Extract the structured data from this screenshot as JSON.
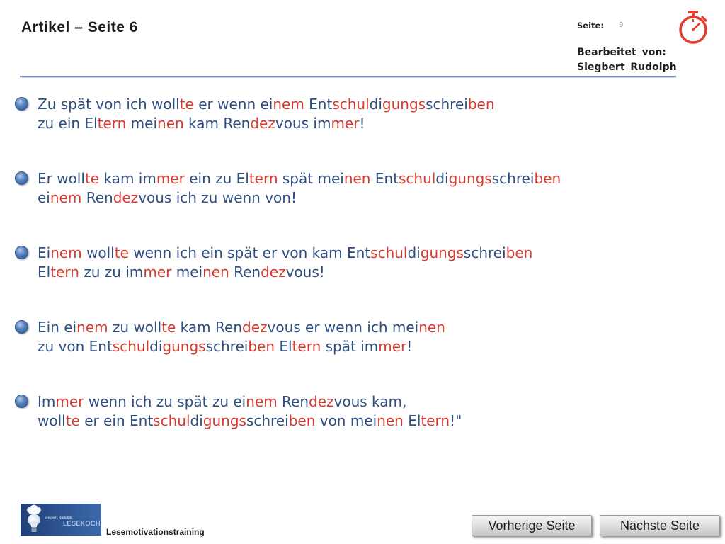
{
  "header": {
    "title": "Artikel – Seite 6",
    "page_label": "Seite:",
    "page_number": "9",
    "edited_by_label": "Bearbeitet von:",
    "author": "Siegbert Rudolph",
    "timer_icon": "stopwatch-icon"
  },
  "colors": {
    "text_blue": "#2f4e80",
    "text_red": "#d63a2f",
    "bullet": "#3d68a6",
    "divider": "#7a93c2",
    "timer": "#e33b2c"
  },
  "options": [
    {
      "lines": [
        [
          {
            "t": "Zu spät von ich woll"
          },
          {
            "t": "te",
            "red": true
          },
          {
            "t": " er wenn ei"
          },
          {
            "t": "nem",
            "red": true
          },
          {
            "t": " Ent"
          },
          {
            "t": "schul",
            "red": true
          },
          {
            "t": "di"
          },
          {
            "t": "gungs",
            "red": true
          },
          {
            "t": "schrei"
          },
          {
            "t": "ben",
            "red": true
          }
        ],
        [
          {
            "t": "zu ein El"
          },
          {
            "t": "tern",
            "red": true
          },
          {
            "t": " mei"
          },
          {
            "t": "nen",
            "red": true
          },
          {
            "t": " kam Ren"
          },
          {
            "t": "dez",
            "red": true
          },
          {
            "t": "vous im"
          },
          {
            "t": "mer",
            "red": true
          },
          {
            "t": "!"
          }
        ]
      ]
    },
    {
      "lines": [
        [
          {
            "t": "Er woll"
          },
          {
            "t": "te",
            "red": true
          },
          {
            "t": " kam im"
          },
          {
            "t": "mer",
            "red": true
          },
          {
            "t": " ein zu El"
          },
          {
            "t": "tern",
            "red": true
          },
          {
            "t": " spät mei"
          },
          {
            "t": "nen",
            "red": true
          },
          {
            "t": " Ent"
          },
          {
            "t": "schul",
            "red": true
          },
          {
            "t": "di"
          },
          {
            "t": "gungs",
            "red": true
          },
          {
            "t": "schrei"
          },
          {
            "t": "ben",
            "red": true
          }
        ],
        [
          {
            "t": "ei"
          },
          {
            "t": "nem",
            "red": true
          },
          {
            "t": " Ren"
          },
          {
            "t": "dez",
            "red": true
          },
          {
            "t": "vous ich zu wenn von!"
          }
        ]
      ]
    },
    {
      "lines": [
        [
          {
            "t": "Ei"
          },
          {
            "t": "nem",
            "red": true
          },
          {
            "t": " woll"
          },
          {
            "t": "te",
            "red": true
          },
          {
            "t": " wenn ich ein spät er von kam Ent"
          },
          {
            "t": "schul",
            "red": true
          },
          {
            "t": "di"
          },
          {
            "t": "gungs",
            "red": true
          },
          {
            "t": "schrei"
          },
          {
            "t": "ben",
            "red": true
          }
        ],
        [
          {
            "t": "El"
          },
          {
            "t": "tern",
            "red": true
          },
          {
            "t": " zu zu im"
          },
          {
            "t": "mer",
            "red": true
          },
          {
            "t": " mei"
          },
          {
            "t": "nen",
            "red": true
          },
          {
            "t": " Ren"
          },
          {
            "t": "dez",
            "red": true
          },
          {
            "t": "vous!"
          }
        ]
      ]
    },
    {
      "lines": [
        [
          {
            "t": "Ein ei"
          },
          {
            "t": "nem",
            "red": true
          },
          {
            "t": " zu woll"
          },
          {
            "t": "te",
            "red": true
          },
          {
            "t": " kam Ren"
          },
          {
            "t": "dez",
            "red": true
          },
          {
            "t": "vous er wenn ich mei"
          },
          {
            "t": "nen",
            "red": true
          }
        ],
        [
          {
            "t": "zu von Ent"
          },
          {
            "t": "schul",
            "red": true
          },
          {
            "t": "di"
          },
          {
            "t": "gungs",
            "red": true
          },
          {
            "t": "schrei"
          },
          {
            "t": "ben",
            "red": true
          },
          {
            "t": " El"
          },
          {
            "t": "tern",
            "red": true
          },
          {
            "t": " spät im"
          },
          {
            "t": "mer",
            "red": true
          },
          {
            "t": "!"
          }
        ]
      ]
    },
    {
      "lines": [
        [
          {
            "t": "Im"
          },
          {
            "t": "mer",
            "red": true
          },
          {
            "t": " wenn ich zu spät zu ei"
          },
          {
            "t": "nem",
            "red": true
          },
          {
            "t": " Ren"
          },
          {
            "t": "dez",
            "red": true
          },
          {
            "t": "vous kam,"
          }
        ],
        [
          {
            "t": "woll"
          },
          {
            "t": "te",
            "red": true
          },
          {
            "t": " er ein Ent"
          },
          {
            "t": "schul",
            "red": true
          },
          {
            "t": "di"
          },
          {
            "t": "gungs",
            "red": true
          },
          {
            "t": "schrei"
          },
          {
            "t": "ben",
            "red": true
          },
          {
            "t": " von mei"
          },
          {
            "t": "nen",
            "red": true
          },
          {
            "t": " El"
          },
          {
            "t": "tern",
            "red": true
          },
          {
            "t": "!\""
          }
        ]
      ]
    }
  ],
  "footer": {
    "logo": {
      "icon": "lesekoch-logo",
      "top_text": "Siegbert Rudolph",
      "brand": "LESEKOCH"
    },
    "caption": "Lesemotivationstraining",
    "prev_button": "Vorherige Seite",
    "next_button": "Nächste Seite"
  }
}
